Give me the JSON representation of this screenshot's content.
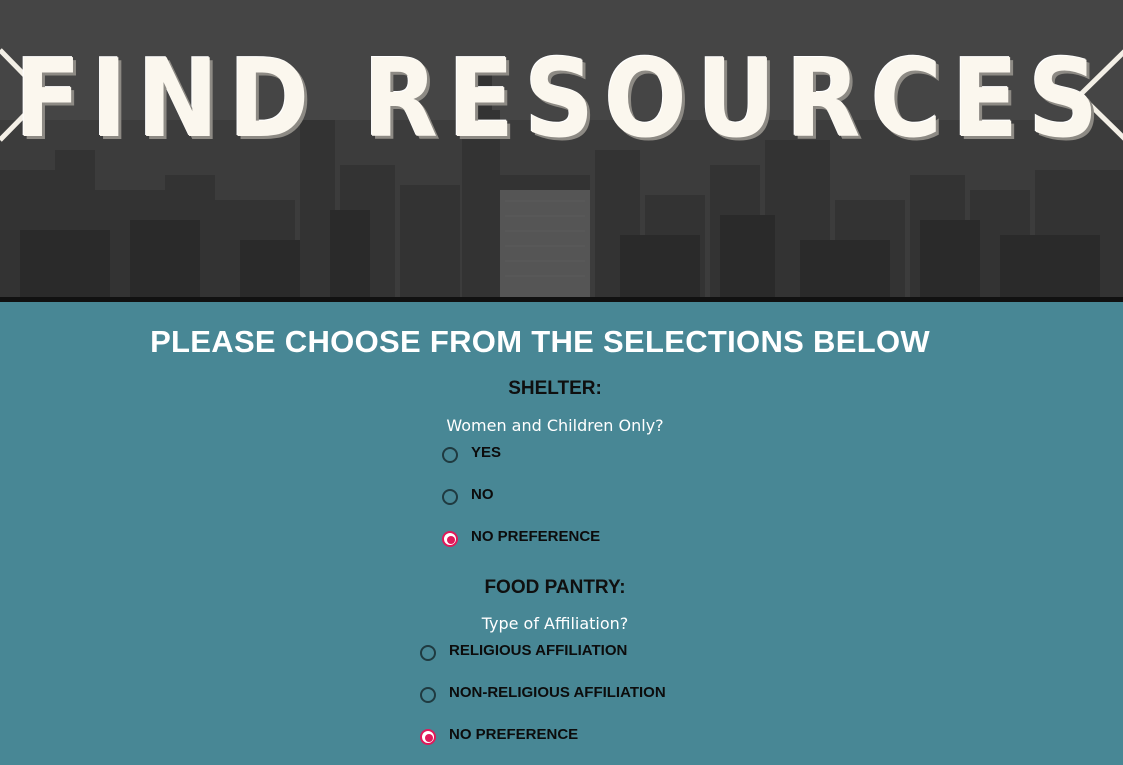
{
  "hero": {
    "title": "FIND RESOURCES"
  },
  "main": {
    "heading": "PLEASE CHOOSE FROM THE SELECTIONS BELOW"
  },
  "shelter": {
    "label": "SHELTER:",
    "question": "Women and Children Only?",
    "options": [
      {
        "label": "YES",
        "checked": false
      },
      {
        "label": "NO",
        "checked": false
      },
      {
        "label": "NO PREFERENCE",
        "checked": true
      }
    ]
  },
  "food_pantry": {
    "label": "FOOD PANTRY:",
    "question": "Type of Affiliation?",
    "options": [
      {
        "label": "RELIGIOUS AFFILIATION",
        "checked": false
      },
      {
        "label": "NON-RELIGIOUS AFFILIATION",
        "checked": false
      },
      {
        "label": "NO PREFERENCE",
        "checked": true
      }
    ]
  },
  "colors": {
    "background": "#488795",
    "radio_selected": "#e0195a",
    "heading_text": "#ffffff"
  }
}
